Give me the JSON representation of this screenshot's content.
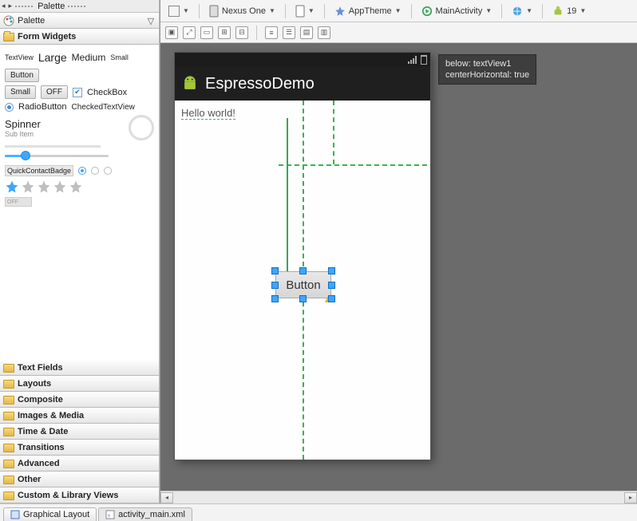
{
  "palette": {
    "title": "Palette",
    "header": "Palette",
    "form_widgets": "Form Widgets",
    "textview_small": "TextView",
    "textview_large": "Large",
    "textview_medium": "Medium",
    "textview_small2": "Small",
    "button_label": "Button",
    "small_btn": "Small",
    "off_btn": "OFF",
    "checkbox_label": "CheckBox",
    "radio_label": "RadioButton",
    "checked_textview": "CheckedTextView",
    "spinner": "Spinner",
    "spinner_sub": "Sub Item",
    "qcb": "QuickContactBadge",
    "toggle_off": "OFF",
    "categories": [
      "Text Fields",
      "Layouts",
      "Composite",
      "Images & Media",
      "Time & Date",
      "Transitions",
      "Advanced",
      "Other",
      "Custom & Library Views"
    ]
  },
  "toolbar": {
    "device": "Nexus One",
    "theme": "AppTheme",
    "activity": "MainActivity",
    "api": "19"
  },
  "device": {
    "app_title": "EspressoDemo",
    "hello": "Hello world!",
    "button": "Button"
  },
  "tooltip": {
    "line1": "below: textView1",
    "line2": "centerHorizontal: true"
  },
  "tabs": {
    "graphical": "Graphical Layout",
    "xml": "activity_main.xml"
  }
}
